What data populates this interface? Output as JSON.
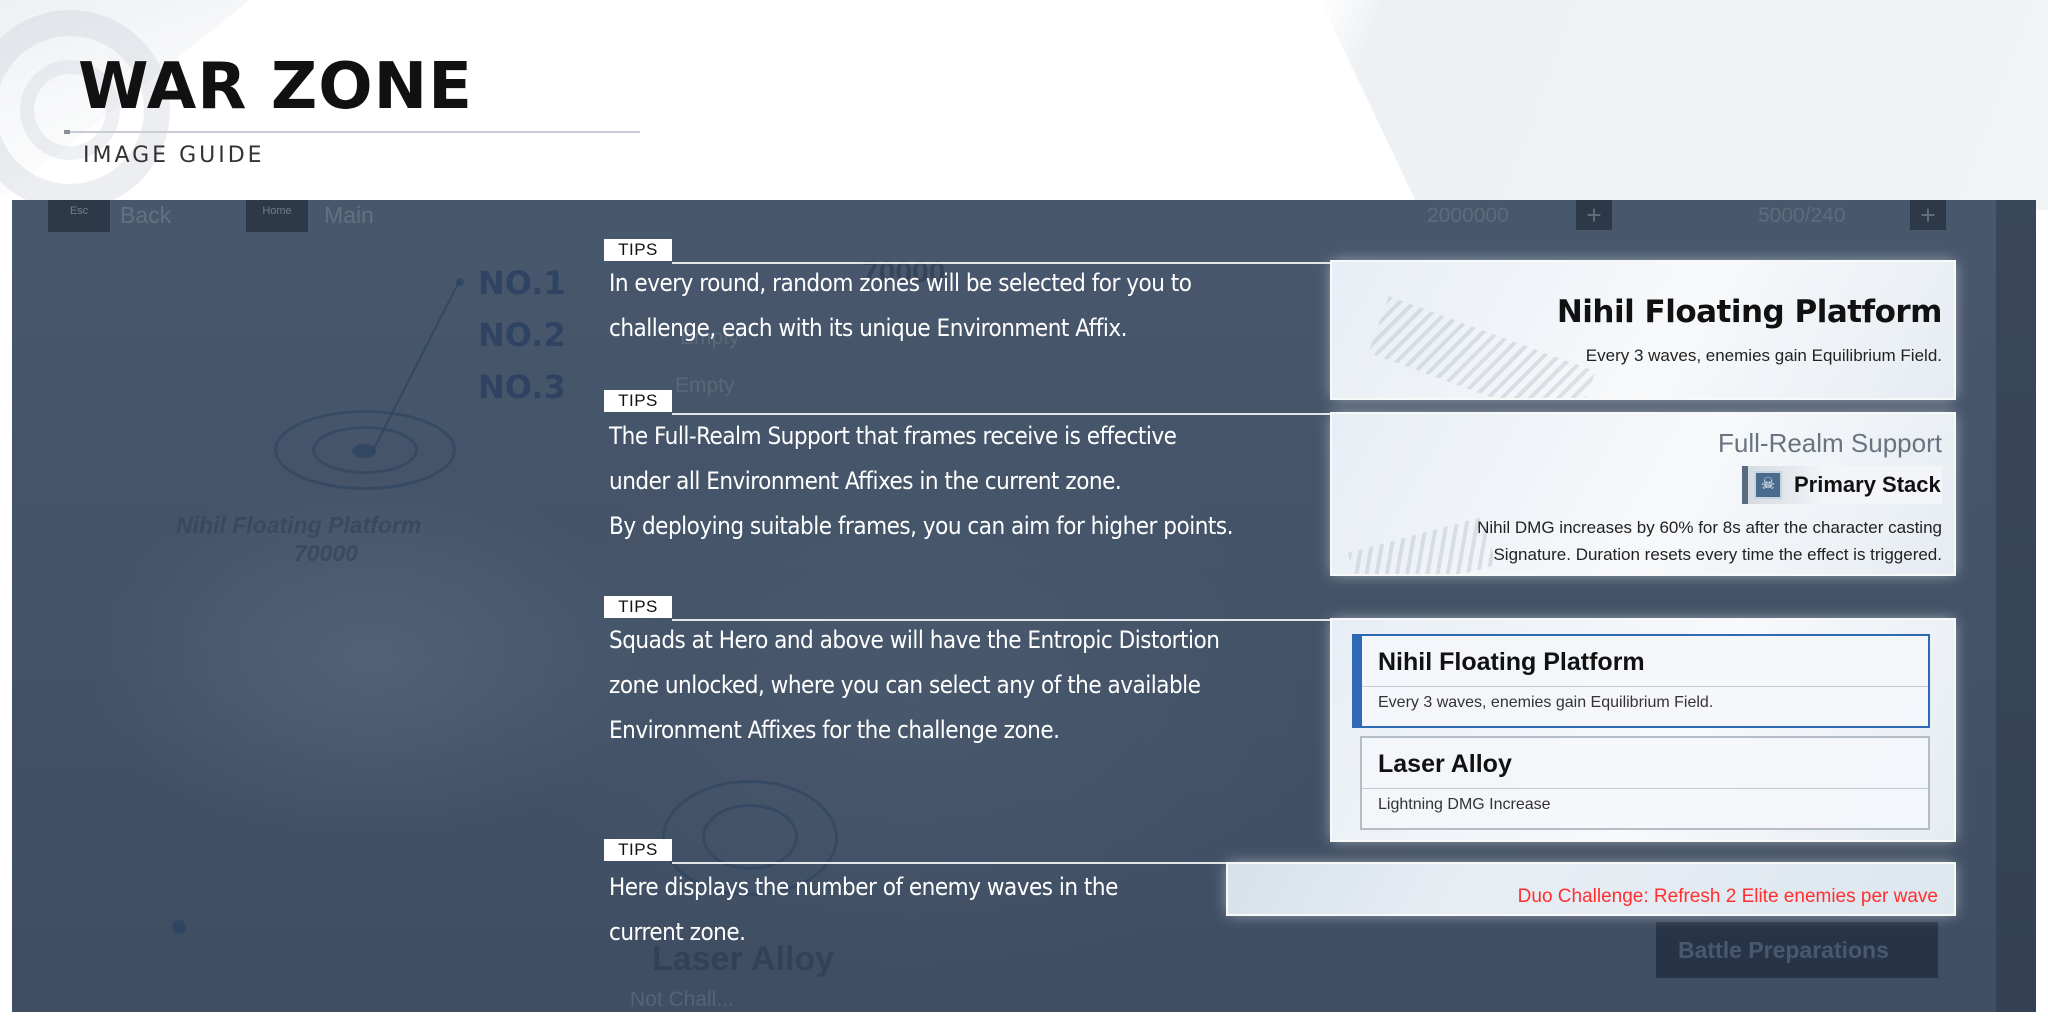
{
  "header": {
    "title": "WAR ZONE",
    "subtitle": "IMAGE GUIDE"
  },
  "game_ui": {
    "esc_key": "Esc",
    "back_label": "Back",
    "home_key": "Home",
    "main_label": "Main",
    "resource_1": "2000000",
    "resource_2": "5000/240",
    "plus_label": "+",
    "ranks": [
      "NO.1",
      "NO.2",
      "NO.3"
    ],
    "partial_score": "70000",
    "empty_label_1": "Empty",
    "empty_label_2": "Empty",
    "zone_name": "Nihil Floating Platform",
    "zone_score": "70000",
    "laser_alloy": "Laser Alloy",
    "not_challenged": "Not Chall...",
    "battle_button": "Battle Preparations"
  },
  "tips": [
    {
      "tag": "TIPS",
      "lines": [
        "In every round, random zones will be selected for you to",
        "challenge, each with its unique Environment Affix."
      ]
    },
    {
      "tag": "TIPS",
      "lines": [
        "The Full-Realm Support that frames receive is effective",
        "under all Environment Affixes in the current zone.",
        "By deploying suitable frames, you can aim for higher points."
      ]
    },
    {
      "tag": "TIPS",
      "lines": [
        "Squads at Hero and above will have the Entropic Distortion",
        "zone unlocked, where you can select any of the available",
        "Environment Affixes for the challenge zone."
      ]
    },
    {
      "tag": "TIPS",
      "lines": [
        "Here displays the number of enemy waves in the",
        "current zone."
      ]
    }
  ],
  "panel_zone": {
    "title": "Nihil Floating Platform",
    "desc": "Every 3 waves, enemies gain Equilibrium Field."
  },
  "panel_support": {
    "title": "Full-Realm Support",
    "badge_icon": "skull-icon",
    "badge_label": "Primary Stack",
    "desc_lines": [
      "Nihil DMG increases by 60% for 8s after the character casting",
      "Signature. Duration resets every time the effect is triggered."
    ]
  },
  "panel_affixes": [
    {
      "title": "Nihil Floating Platform",
      "desc": "Every 3 waves, enemies gain Equilibrium Field.",
      "selected": true
    },
    {
      "title": "Laser Alloy",
      "desc": "Lightning DMG Increase",
      "selected": false
    }
  ],
  "panel_waves": {
    "text": "Duo Challenge: Refresh 2 Elite enemies per wave",
    "text_color": "#ff2f2f"
  },
  "colors": {
    "accent_blue": "#2d6ab3",
    "overlay": "#54657a"
  }
}
